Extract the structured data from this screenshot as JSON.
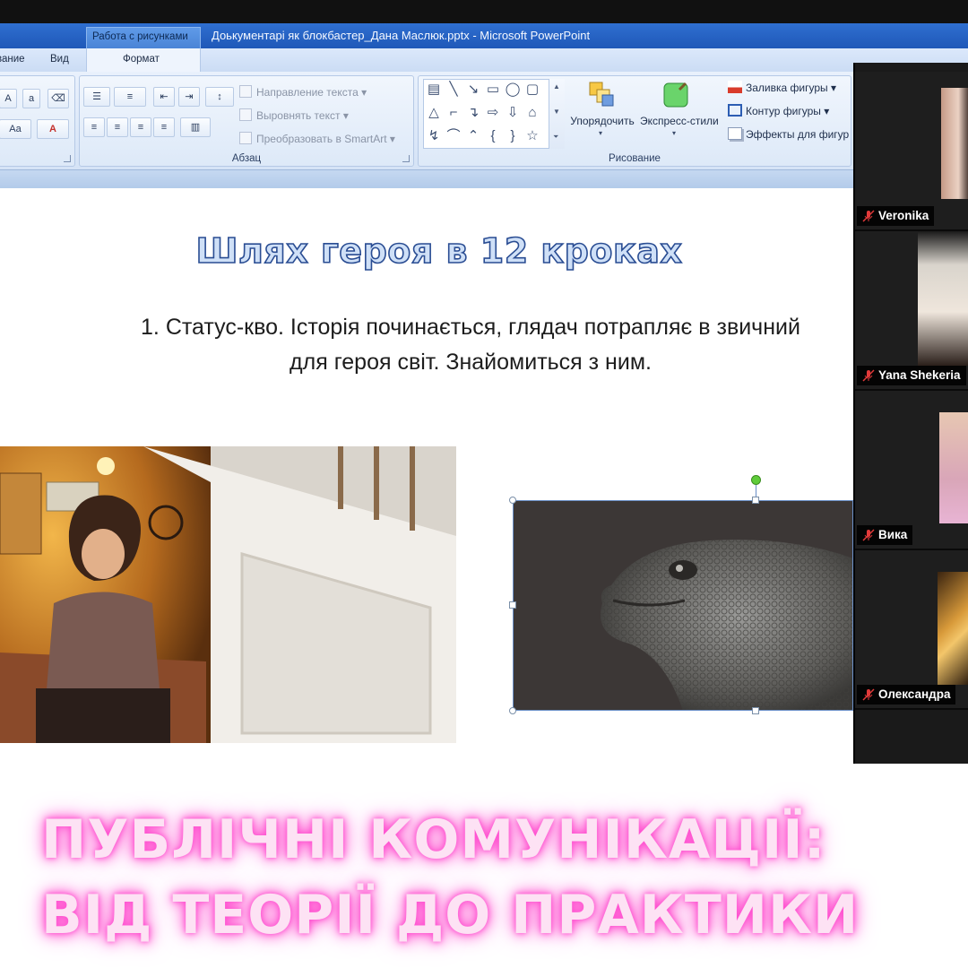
{
  "window": {
    "context_tab": "Работа с рисунками",
    "title": "Доькументарі як блокбастер_Дана Маслюк.pptx - Microsoft PowerPoint"
  },
  "tabs": {
    "left_partial": "вание",
    "view": "Вид",
    "format": "Формат"
  },
  "ribbon": {
    "paragraph": {
      "label": "Абзац",
      "text_direction": "Направление текста",
      "align_text": "Выровнять текст",
      "convert_smartart": "Преобразовать в SmartArt"
    },
    "drawing": {
      "label": "Рисование",
      "arrange": "Упорядочить",
      "quick_styles": "Экспресс-стили",
      "shape_fill": "Заливка фигуры",
      "shape_outline": "Контур фигуры",
      "shape_effects": "Эффекты для фигур"
    }
  },
  "slide": {
    "title": "Шлях героя в 12 кроках",
    "body": "1. Статус-кво. Історія починається, глядач потрапляє в звичний для героя світ. Знайомиться з ним."
  },
  "participants": [
    {
      "name": "Veronika",
      "muted": true
    },
    {
      "name": "Yana Shekeria",
      "muted": true
    },
    {
      "name": "Вика",
      "muted": true
    },
    {
      "name": "Олександра",
      "muted": true
    }
  ],
  "banner": {
    "line1": "ПУБЛІЧНІ КОМУНІКАЦІЇ:",
    "line2": "ВІД ТЕОРІЇ ДО ПРАКТИКИ"
  }
}
